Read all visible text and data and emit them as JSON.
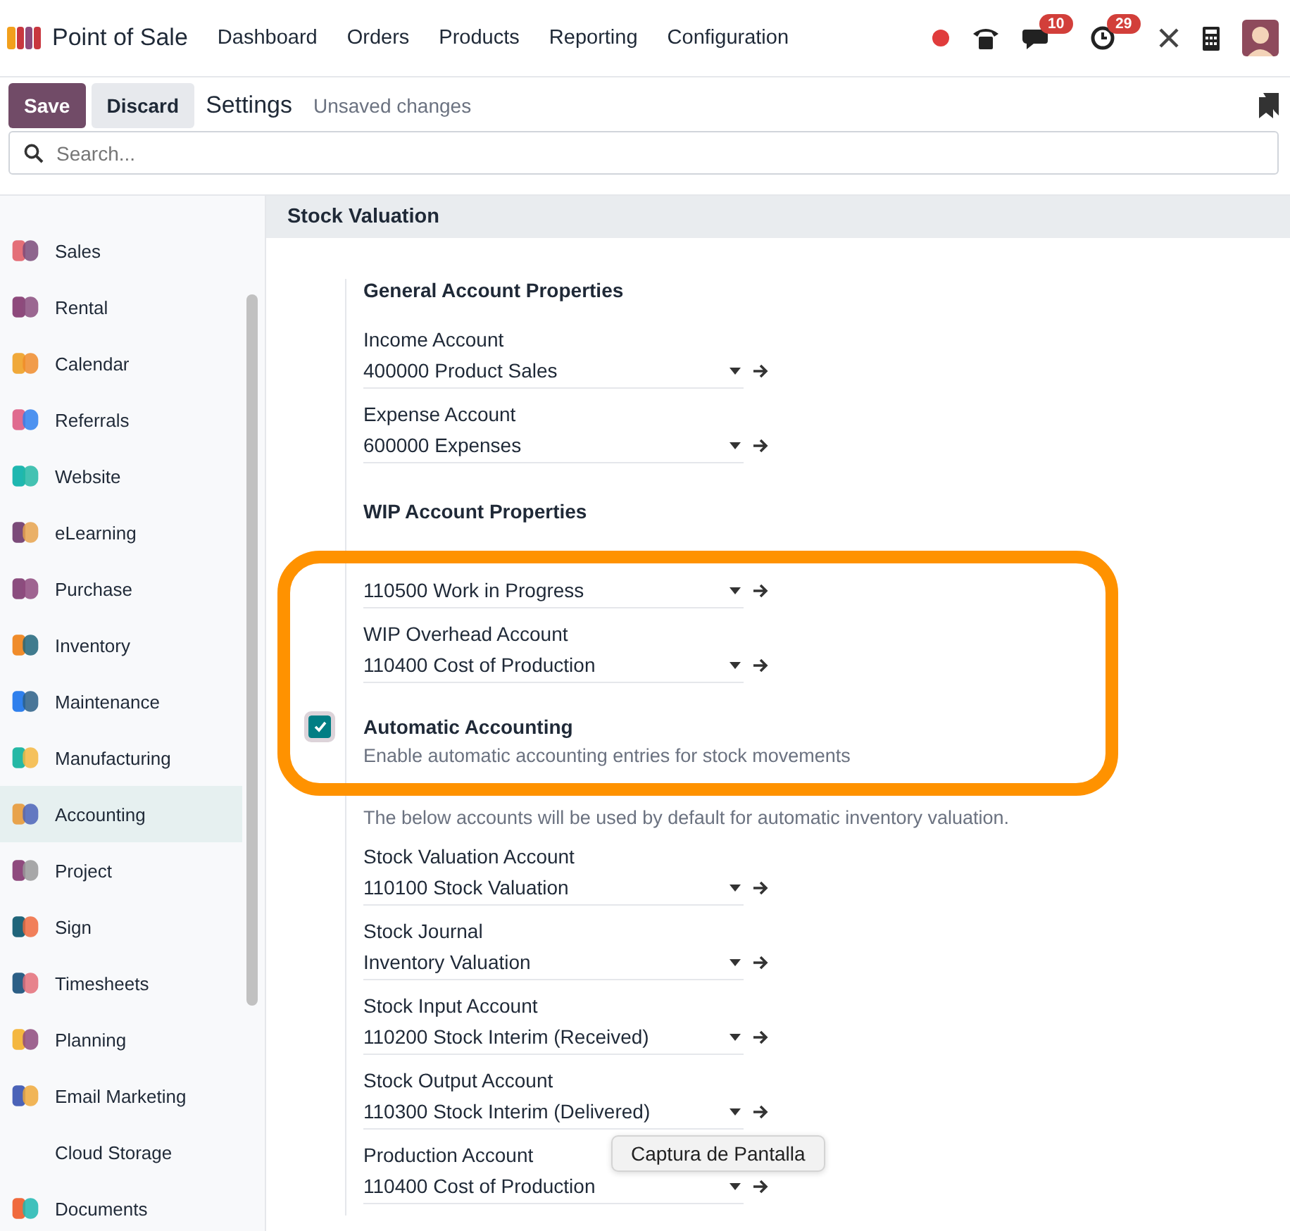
{
  "navbar": {
    "app_name": "Point of Sale",
    "menu": [
      "Dashboard",
      "Orders",
      "Products",
      "Reporting",
      "Configuration"
    ],
    "messages_badge": "10",
    "activities_badge": "29"
  },
  "control_panel": {
    "save": "Save",
    "discard": "Discard",
    "breadcrumb": "Settings",
    "status": "Unsaved changes",
    "search": {
      "placeholder": "Search..."
    }
  },
  "sidebar": {
    "items": [
      {
        "label": "Sales",
        "selected": false,
        "icon": true
      },
      {
        "label": "Rental",
        "selected": false,
        "icon": true
      },
      {
        "label": "Calendar",
        "selected": false,
        "icon": true
      },
      {
        "label": "Referrals",
        "selected": false,
        "icon": true
      },
      {
        "label": "Website",
        "selected": false,
        "icon": true
      },
      {
        "label": "eLearning",
        "selected": false,
        "icon": true
      },
      {
        "label": "Purchase",
        "selected": false,
        "icon": true
      },
      {
        "label": "Inventory",
        "selected": false,
        "icon": true
      },
      {
        "label": "Maintenance",
        "selected": false,
        "icon": true
      },
      {
        "label": "Manufacturing",
        "selected": false,
        "icon": true
      },
      {
        "label": "Accounting",
        "selected": true,
        "icon": true
      },
      {
        "label": "Project",
        "selected": false,
        "icon": true
      },
      {
        "label": "Sign",
        "selected": false,
        "icon": true
      },
      {
        "label": "Timesheets",
        "selected": false,
        "icon": true
      },
      {
        "label": "Planning",
        "selected": false,
        "icon": true
      },
      {
        "label": "Email Marketing",
        "selected": false,
        "icon": true
      },
      {
        "label": "Cloud Storage",
        "selected": false,
        "icon": false
      },
      {
        "label": "Documents",
        "selected": false,
        "icon": true
      }
    ]
  },
  "section": {
    "title": "Stock Valuation",
    "groups": [
      {
        "title": "General Account Properties",
        "fields": [
          {
            "label": "Income Account",
            "value": "400000 Product Sales"
          },
          {
            "label": "Expense Account",
            "value": "600000 Expenses"
          }
        ]
      },
      {
        "title": "WIP Account Properties",
        "fields": [
          {
            "value": "110500 Work in Progress"
          },
          {
            "label": "WIP Overhead Account",
            "value": "110400 Cost of Production"
          }
        ]
      }
    ],
    "setting": {
      "title": "Automatic Accounting",
      "description": "Enable automatic accounting entries for stock movements",
      "checked": true,
      "note": "The below accounts will be used by default for automatic inventory valuation.",
      "fields": [
        {
          "label": "Stock Valuation Account",
          "value": "110100 Stock Valuation"
        },
        {
          "label": "Stock Journal",
          "value": "Inventory Valuation"
        },
        {
          "label": "Stock Input Account",
          "value": "110200 Stock Interim (Received)"
        },
        {
          "label": "Stock Output Account",
          "value": "110300 Stock Interim (Delivered)"
        },
        {
          "label": "Production Account",
          "value": "110400 Cost of Production"
        }
      ]
    }
  },
  "tooltip": "Captura de Pantalla"
}
